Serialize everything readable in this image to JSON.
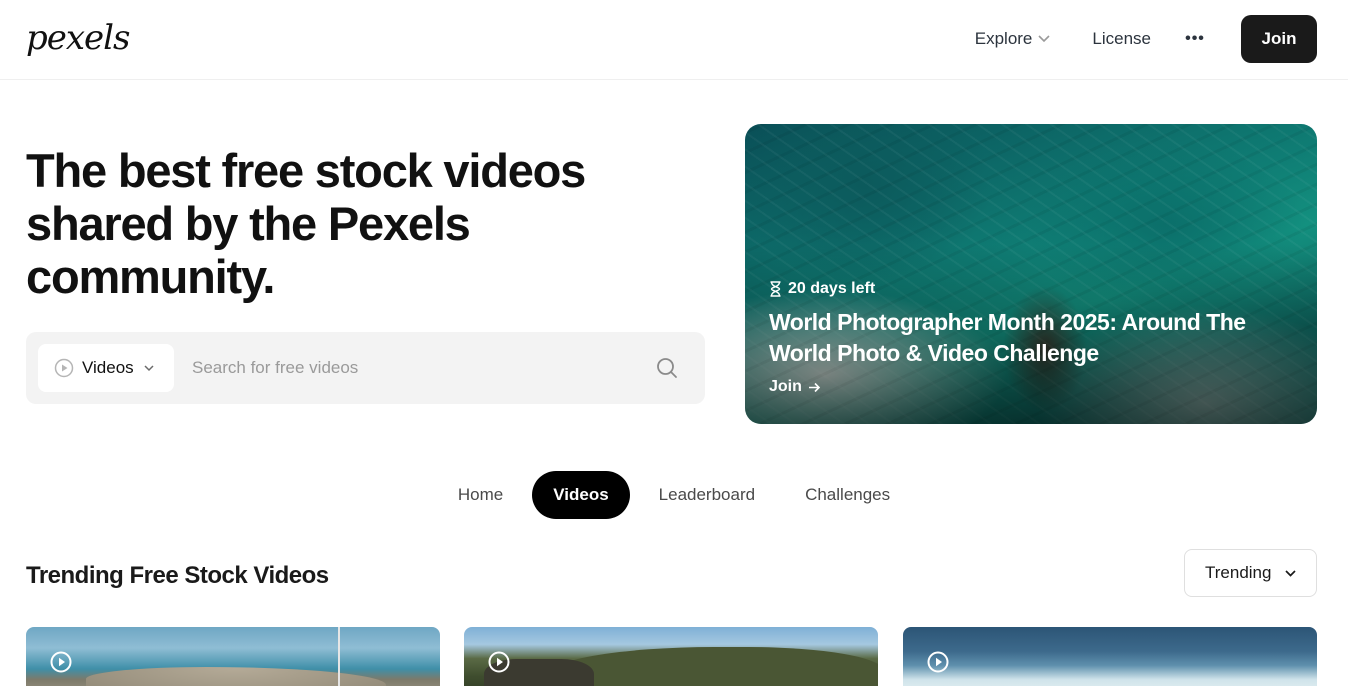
{
  "header": {
    "logo": "pexels",
    "nav": {
      "explore": "Explore",
      "license": "License",
      "more": "•••",
      "join": "Join"
    }
  },
  "hero": {
    "title": "The best free stock videos shared by the Pexels community.",
    "search": {
      "type_label": "Videos",
      "placeholder": "Search for free videos"
    }
  },
  "challenge": {
    "days_left": "20 days left",
    "title": "World Photographer Month 2025: Around The World Photo & Video Challenge",
    "cta": "Join"
  },
  "tabs": [
    {
      "label": "Home",
      "active": false
    },
    {
      "label": "Videos",
      "active": true
    },
    {
      "label": "Leaderboard",
      "active": false
    },
    {
      "label": "Challenges",
      "active": false
    }
  ],
  "section": {
    "title": "Trending Free Stock Videos",
    "sort_label": "Trending"
  },
  "colors": {
    "primary": "#1a1a1a",
    "search_bg": "#f3f3f3",
    "active_tab": "#000000"
  },
  "icons": {
    "explore_chevron": "chevron-down-icon",
    "more": "more-horizontal-icon",
    "search_type": "play-circle-icon",
    "search": "search-icon",
    "days_left": "hourglass-icon",
    "join_arrow": "arrow-right-icon",
    "sort_chevron": "chevron-down-icon",
    "video": "play-circle-icon"
  }
}
